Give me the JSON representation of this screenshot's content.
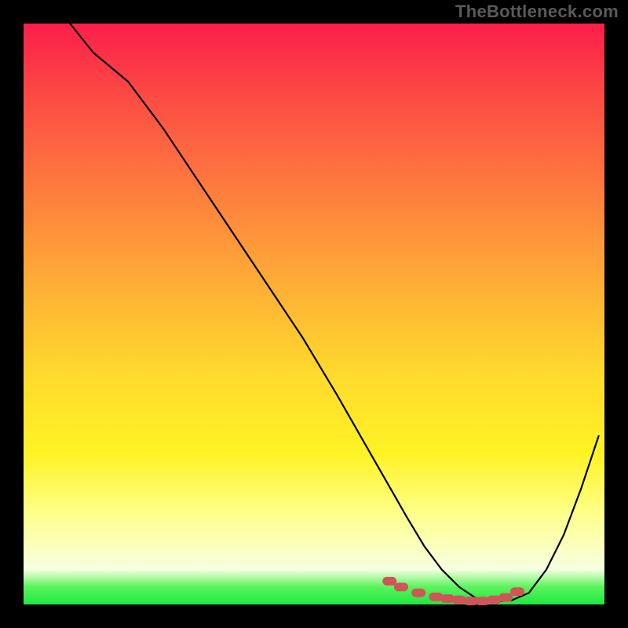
{
  "attribution": "TheBottleneck.com",
  "colors": {
    "page_bg": "#000000",
    "attribution_text": "#5a5a5a",
    "curve_stroke": "#000000",
    "marker_fill": "#cf5558",
    "gradient_stops": [
      "#fb1e4a",
      "#fc4944",
      "#fd7a3e",
      "#feab36",
      "#fed92d",
      "#fff324",
      "#feff86",
      "#fbffbe",
      "#f6ffe1",
      "#5bf35d",
      "#1de940"
    ]
  },
  "chart_data": {
    "type": "line",
    "title": "",
    "xlabel": "",
    "ylabel": "",
    "xlim": [
      0,
      100
    ],
    "ylim": [
      0,
      100
    ],
    "grid": false,
    "series": [
      {
        "name": "bottleneck-curve",
        "x": [
          8,
          12,
          18,
          24,
          30,
          36,
          42,
          48,
          54,
          58,
          62,
          66,
          69,
          72,
          75,
          78,
          81,
          84,
          87,
          90,
          93,
          96,
          99
        ],
        "values": [
          100,
          95,
          90,
          82,
          73,
          64,
          55,
          46,
          36,
          29,
          22,
          15,
          10,
          6,
          3,
          1,
          0.5,
          0.7,
          2,
          6,
          12,
          20,
          29
        ]
      }
    ],
    "markers": {
      "name": "highlight-dots",
      "x": [
        63,
        65,
        68,
        71,
        73,
        75,
        77,
        79,
        81,
        83,
        85
      ],
      "values": [
        4,
        3,
        2,
        1.3,
        1,
        0.8,
        0.6,
        0.6,
        0.8,
        1.2,
        2.2
      ]
    }
  }
}
